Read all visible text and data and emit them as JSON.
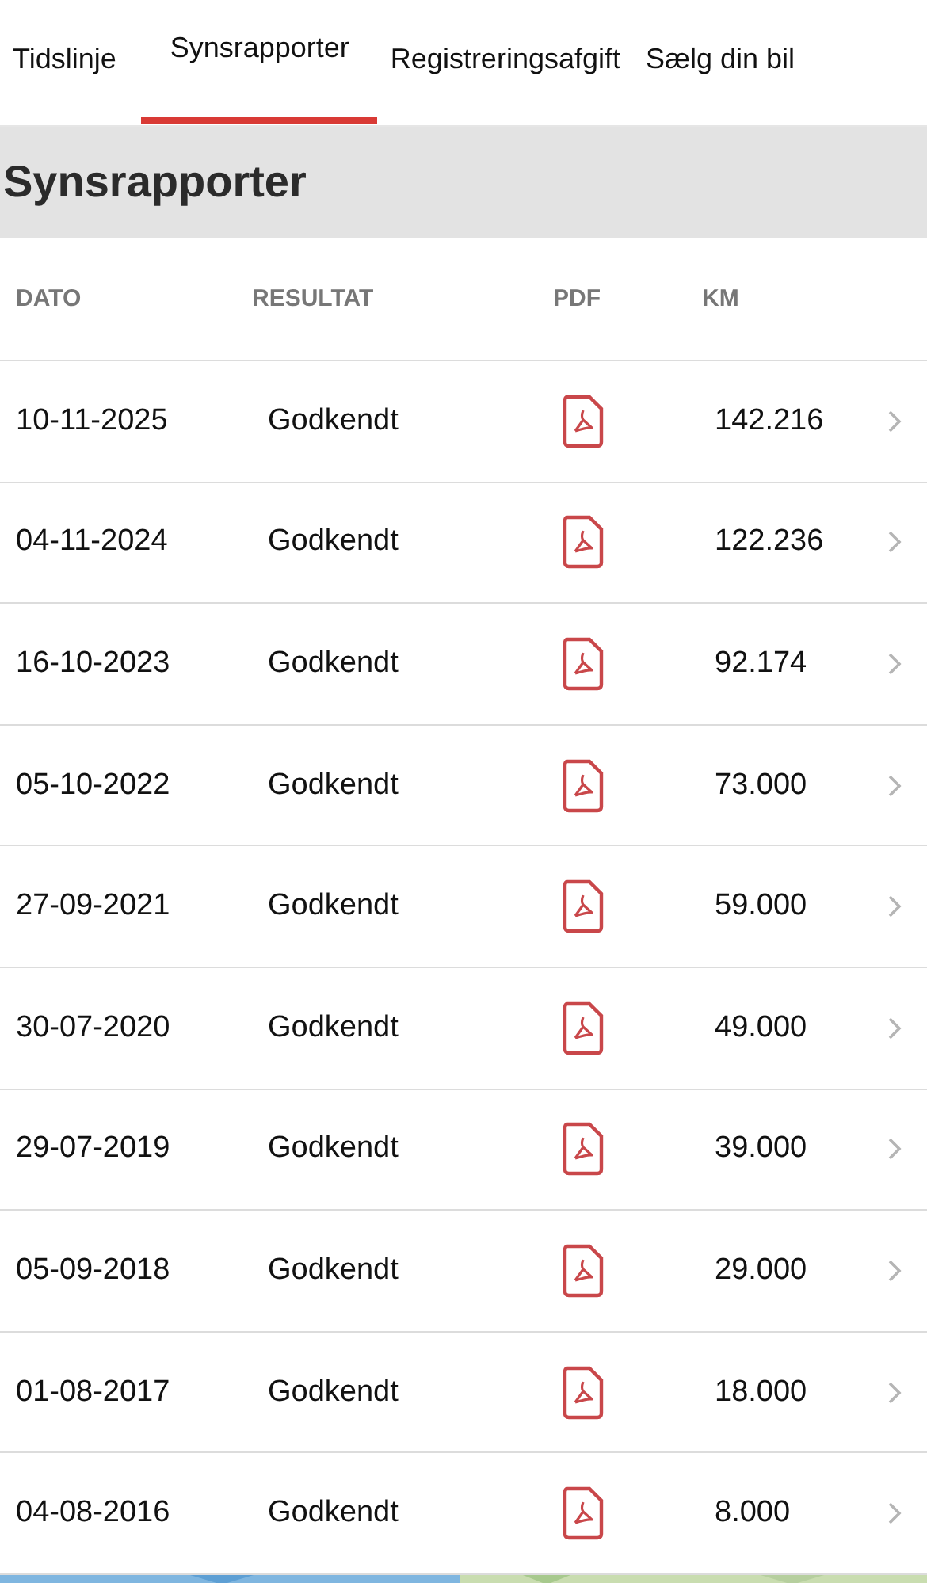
{
  "tabs": [
    {
      "label": "Tidslinje",
      "selected": false
    },
    {
      "label": "Synsrapporter",
      "selected": true
    },
    {
      "label": "Registreringsafgift",
      "selected": false
    },
    {
      "label": "Sælg din bil",
      "selected": false
    }
  ],
  "section_title": "Synsrapporter",
  "table": {
    "columns": [
      "DATO",
      "RESULTAT",
      "PDF",
      "KM"
    ],
    "rows": [
      {
        "date": "10-11-2025",
        "result": "Godkendt",
        "km": "142.216"
      },
      {
        "date": "04-11-2024",
        "result": "Godkendt",
        "km": "122.236"
      },
      {
        "date": "16-10-2023",
        "result": "Godkendt",
        "km": "92.174"
      },
      {
        "date": "05-10-2022",
        "result": "Godkendt",
        "km": "73.000"
      },
      {
        "date": "27-09-2021",
        "result": "Godkendt",
        "km": "59.000"
      },
      {
        "date": "30-07-2020",
        "result": "Godkendt",
        "km": "49.000"
      },
      {
        "date": "29-07-2019",
        "result": "Godkendt",
        "km": "39.000"
      },
      {
        "date": "05-09-2018",
        "result": "Godkendt",
        "km": "29.000"
      },
      {
        "date": "01-08-2017",
        "result": "Godkendt",
        "km": "18.000"
      },
      {
        "date": "04-08-2016",
        "result": "Godkendt",
        "km": "8.000"
      }
    ]
  }
}
